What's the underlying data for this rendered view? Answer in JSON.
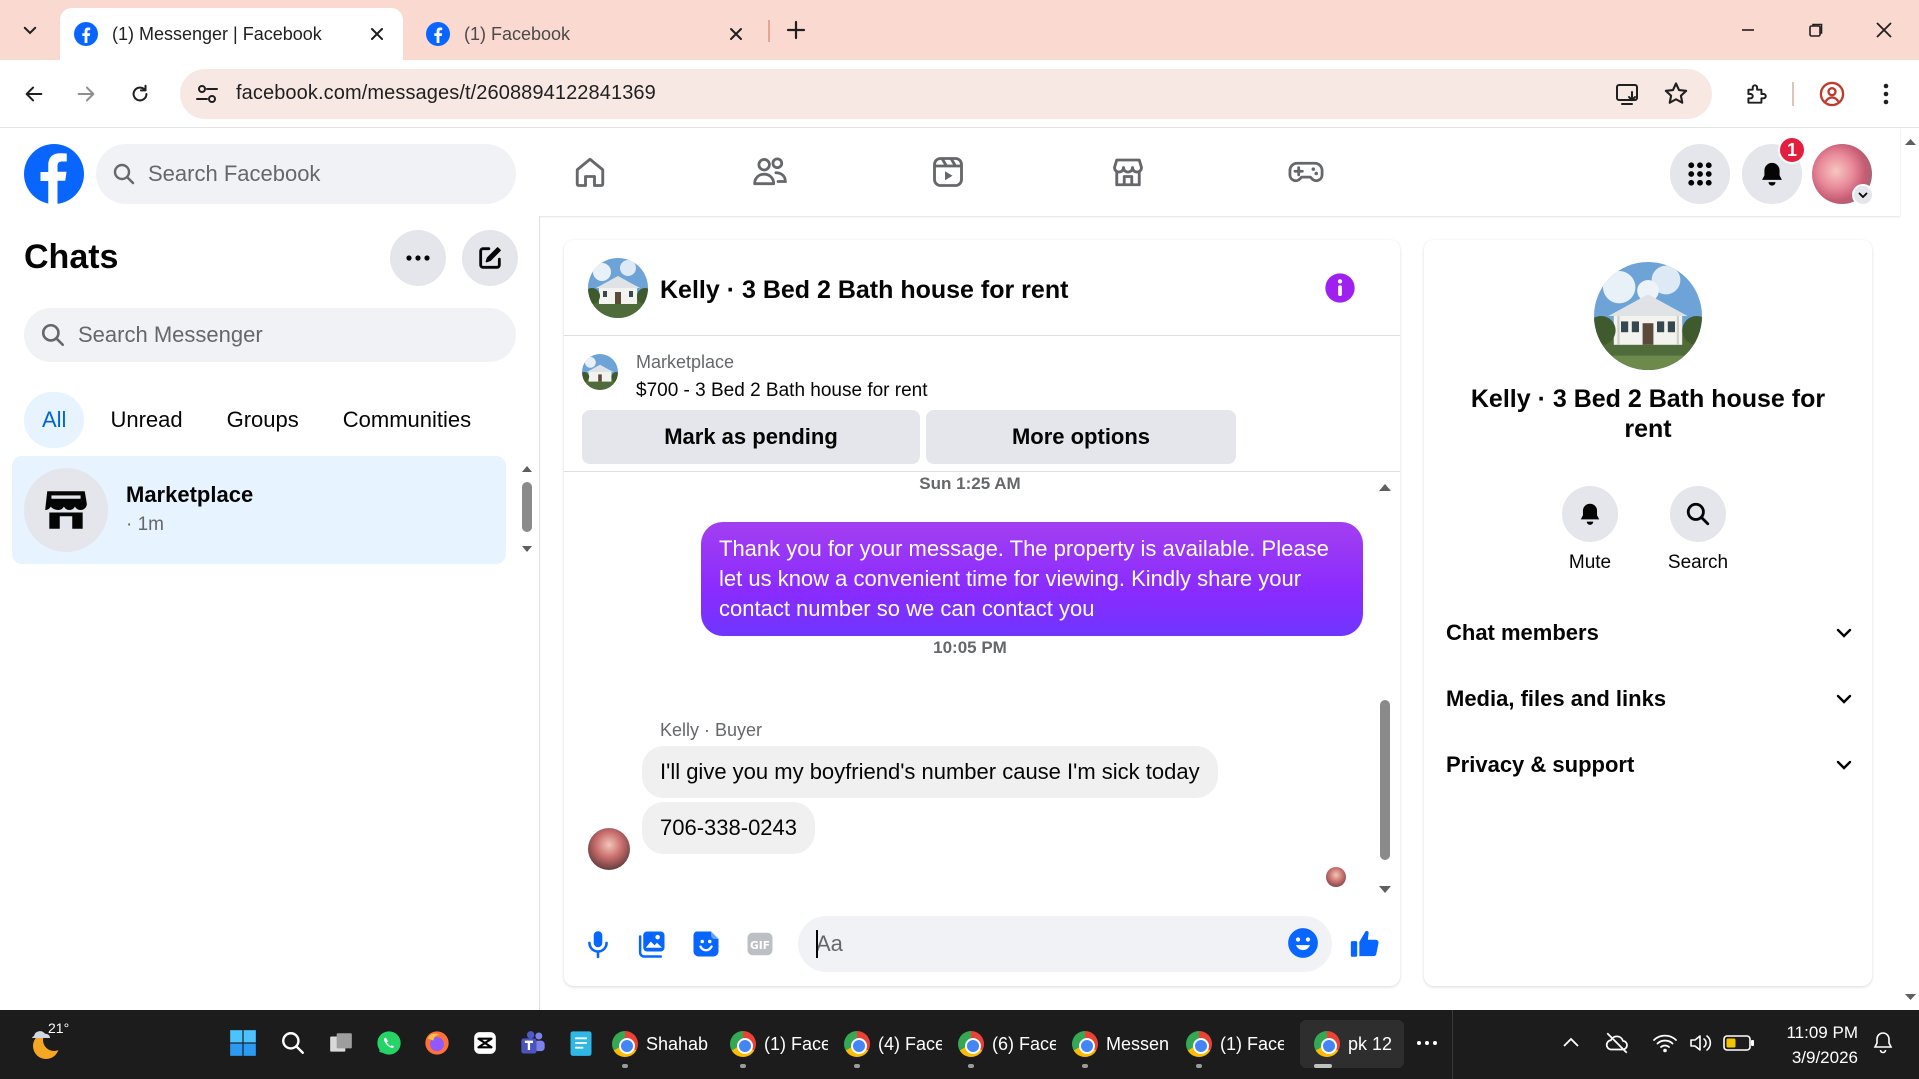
{
  "browser": {
    "tabs": [
      {
        "title": "(1) Messenger | Facebook",
        "active": true
      },
      {
        "title": "(1) Facebook",
        "active": false
      }
    ],
    "url": "facebook.com/messages/t/2608894122841369"
  },
  "fb": {
    "search_placeholder": "Search Facebook",
    "notification_count": "1",
    "brand_color": "#0866ff"
  },
  "chats": {
    "title": "Chats",
    "search_placeholder": "Search Messenger",
    "filters": [
      "All",
      "Unread",
      "Groups",
      "Communities"
    ],
    "conversations": [
      {
        "name": "Marketplace",
        "time": "· 1m"
      }
    ]
  },
  "thread": {
    "title": "Kelly · 3 Bed 2 Bath house for rent",
    "marketplace_label": "Marketplace",
    "listing": "$700 - 3 Bed 2 Bath house for rent",
    "mark_pending": "Mark as pending",
    "more_options": "More options",
    "messages": [
      {
        "timestamp": "Sun 1:25 AM"
      },
      {
        "outgoing": "Thank you for your message. The property is available. Please let us know a convenient time for viewing. Kindly share your contact number so we can contact you"
      },
      {
        "timestamp": "10:05 PM"
      },
      {
        "sender": "Kelly · Buyer"
      },
      {
        "incoming1": "I'll give you my boyfriend's number cause I'm sick today"
      },
      {
        "incoming2": "706-338-0243"
      }
    ],
    "composer_placeholder": "Aa",
    "accent": "#8a2bff"
  },
  "info": {
    "name": "Kelly · 3 Bed 2 Bath house for rent",
    "actions": [
      "Mute",
      "Search"
    ],
    "sections": [
      "Chat members",
      "Media, files and links",
      "Privacy & support"
    ]
  },
  "taskbar": {
    "weather_temp": "21°",
    "apps": [
      "Shahab",
      "(1) Face",
      "(4) Face",
      "(6) Face",
      "Messen",
      "(1) Face",
      "pk 12"
    ],
    "time": "11:09 PM",
    "date": "3/9/2026"
  }
}
